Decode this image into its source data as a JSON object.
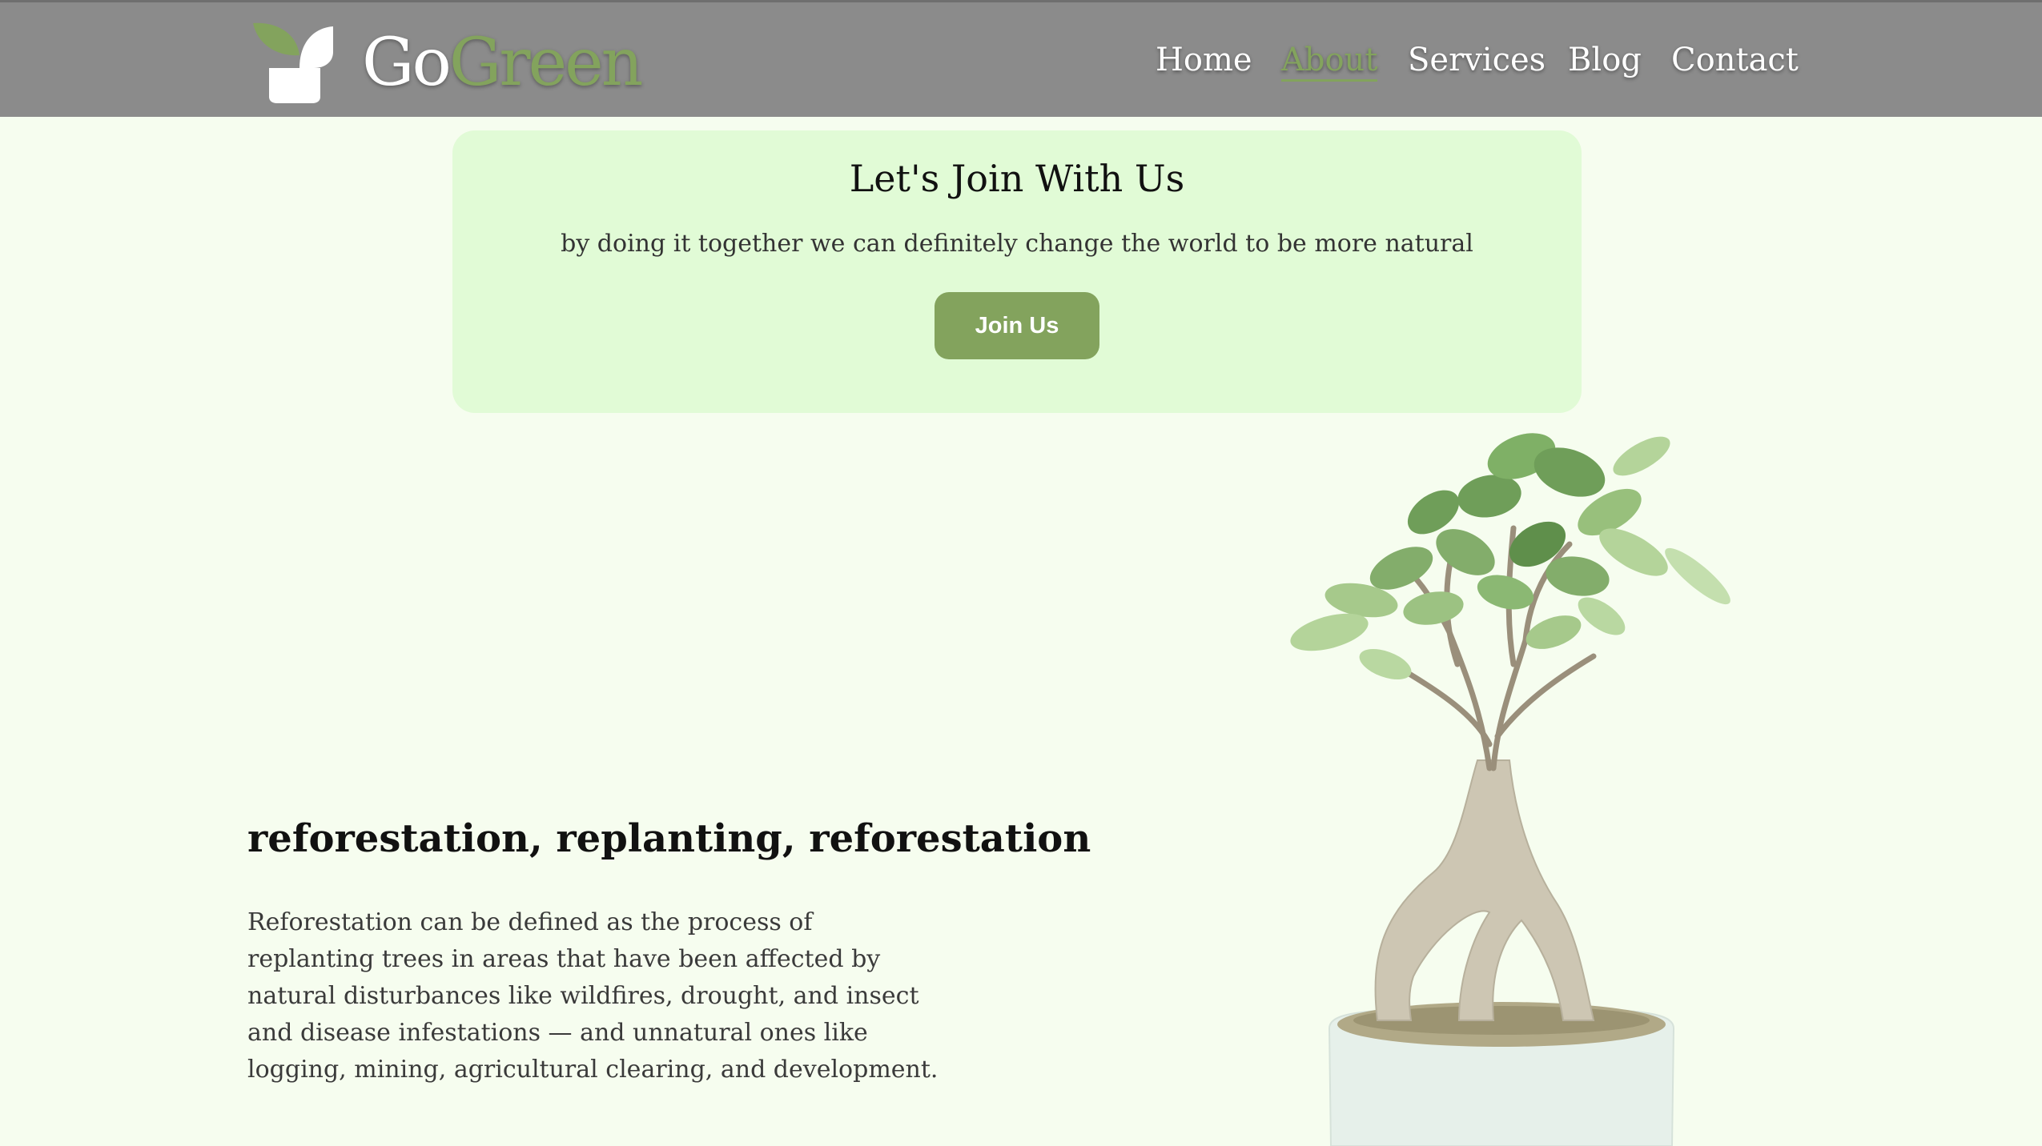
{
  "header": {
    "brand_part1": "Go",
    "brand_part2": "Green",
    "nav": [
      {
        "label": "Home",
        "active": false
      },
      {
        "label": "About",
        "active": true
      },
      {
        "label": "Services",
        "active": false
      },
      {
        "label": "Blog",
        "active": false
      },
      {
        "label": "Contact",
        "active": false
      }
    ]
  },
  "join": {
    "title": "Let's Join With Us",
    "subtitle": "by doing it together we can definitely change the world to be more natural",
    "button_label": "Join Us"
  },
  "article": {
    "title": "reforestation, replanting, reforestation",
    "body": "Reforestation can be defined as the process of replanting trees in areas that have been affected by natural disturbances like wildfires, drought, and insect and disease infestations — and unnatural ones like logging, mining, agricultural clearing, and development."
  },
  "colors": {
    "header_bg": "#8b8b8b",
    "accent_green": "#83a35d",
    "page_bg": "#f6fdef",
    "card_bg": "#e1fbd6"
  },
  "icons": {
    "logo": "leaf-pot-icon",
    "plant_image": "bonsai-tree-in-white-pot"
  }
}
